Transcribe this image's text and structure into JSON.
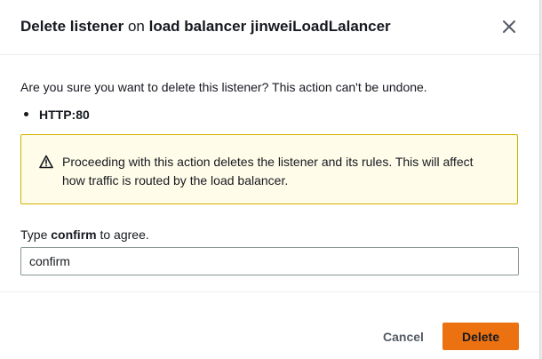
{
  "dialog": {
    "title_prefix": "Delete listener",
    "title_middle": " on ",
    "title_suffix": "load balancer jinweiLoadLalancer",
    "close_icon": "close-icon"
  },
  "body": {
    "question": "Are you sure you want to delete this listener? This action can't be undone.",
    "listener": "HTTP:80"
  },
  "alert": {
    "icon": "warning-icon",
    "text": "Proceeding with this action deletes the listener and its rules. This will affect how traffic is routed by the load balancer."
  },
  "confirm": {
    "label_prefix": "Type ",
    "label_keyword": "confirm",
    "label_suffix": " to agree.",
    "value": "confirm"
  },
  "footer": {
    "cancel_label": "Cancel",
    "delete_label": "Delete"
  },
  "colors": {
    "accent": "#ec7211",
    "alert_bg": "#fffce9",
    "alert_border": "#d4b000"
  }
}
